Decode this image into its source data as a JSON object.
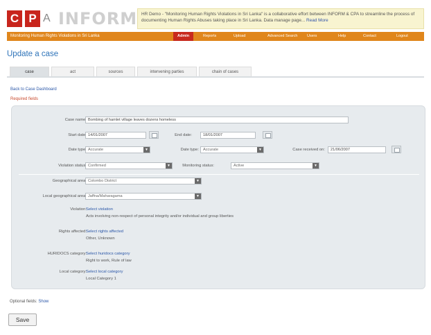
{
  "header": {
    "logo_letter_c": "C",
    "logo_letter_p": "P",
    "logo_letter_a": "A",
    "logo_word": "INFORM",
    "ticker_text": "HR Demo - \"Monitoring Human Rights Violations in Sri Lanka\" is a collaborative effort between INFORM & CPA to streamline the process of documenting Human Rights Abuses taking place in Sri Lanka. Data manage page...",
    "ticker_more": "Read More"
  },
  "nav": {
    "subtitle": "Monitoring Human Rights Violations in Sri Lanka",
    "items": [
      "Admin",
      "Reports",
      "Upload",
      "Advanced Search",
      "Users",
      "Help",
      "Contact",
      "Logout"
    ]
  },
  "page": {
    "title": "Update a case",
    "tabs": [
      "case",
      "act",
      "sources",
      "intervening parties",
      "chain of cases"
    ],
    "back_link": "Back to Case Dashboard",
    "required_note": "Required fields"
  },
  "form": {
    "case_name": {
      "label": "Case name:",
      "value": "Bombing of hamlet village leaves dozens homeless"
    },
    "start_date": {
      "label": "Start date:",
      "value": "14/01/2007"
    },
    "end_date": {
      "label": "End date:",
      "value": "18/01/2007"
    },
    "date_type_1": {
      "label": "Date type:",
      "value": "Accurate"
    },
    "date_type_2": {
      "label": "Date type:",
      "value": "Accurate"
    },
    "case_received": {
      "label": "Case received on:",
      "value": "21/06/2007"
    },
    "violation_status": {
      "label": "Violation status:",
      "value": "Confirmed"
    },
    "monitoring_status": {
      "label": "Monitoring status:",
      "value": "Active"
    },
    "geo_area": {
      "label": "Geographical area:",
      "value": "Colombo District"
    },
    "local_geo_area": {
      "label": "Local geographical area:",
      "value": "Jaffna/Maharagama"
    },
    "violation": {
      "label": "Violation:",
      "link": "Select violation",
      "value": "Acts involving non-respect of personal integrity and/or individual and group liberties"
    },
    "rights_affected": {
      "label": "Rights affected:",
      "link": "Select rights affected",
      "value": "Other, Unknown"
    },
    "huridocs": {
      "label": "HURIDOCS category:",
      "link": "Select huridocs category",
      "value": "Right to work, Rule of law"
    },
    "local_category": {
      "label": "Local category:",
      "link": "Select local category",
      "value": "Local Category 1"
    }
  },
  "footer": {
    "optional_label": "Optional fields:",
    "optional_link": "Show",
    "save_label": "Save"
  }
}
